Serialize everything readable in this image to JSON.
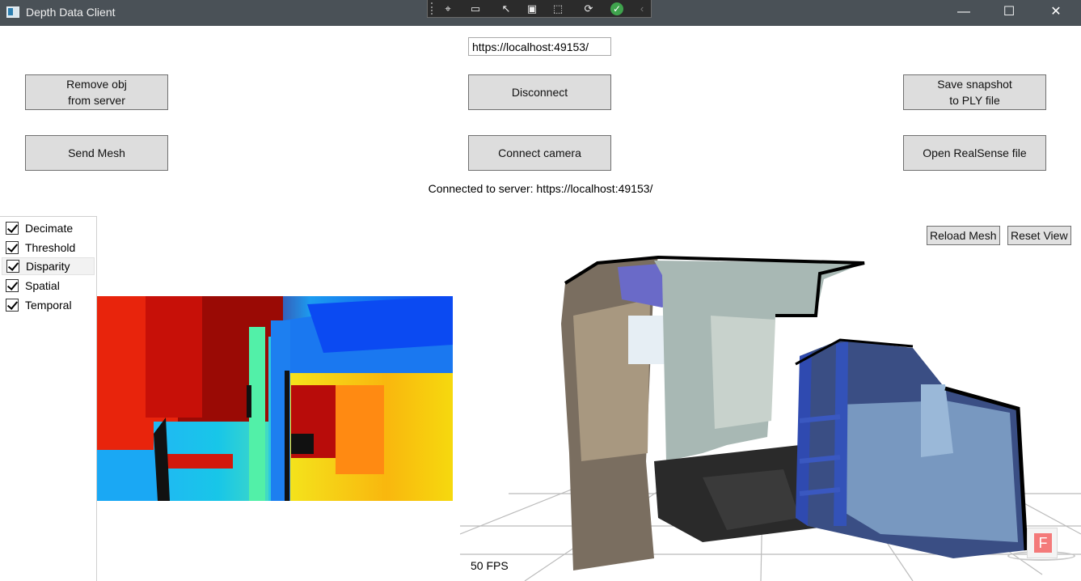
{
  "window": {
    "title": "Depth Data Client",
    "minimize_glyph": "—",
    "maximize_glyph": "☐",
    "close_glyph": "✕"
  },
  "debug_toolbar": {
    "icons": [
      "select-element-icon",
      "video-icon",
      "pointer-select-icon",
      "display-layout-adorners-icon",
      "track-focused-element-icon",
      "hot-reload-icon",
      "check-icon",
      "collapse-chevron-icon"
    ]
  },
  "connection": {
    "url": "https://localhost:49153/",
    "status": "Connected to server: https://localhost:49153/"
  },
  "buttons": {
    "remove_obj": "Remove obj\nfrom server",
    "disconnect": "Disconnect",
    "save_snapshot": "Save snapshot\nto PLY file",
    "send_mesh": "Send Mesh",
    "connect_camera": "Connect camera",
    "open_realsense": "Open RealSense file",
    "reload_mesh": "Reload Mesh",
    "reset_view": "Reset View"
  },
  "filters": [
    {
      "label": "Decimate",
      "checked": true
    },
    {
      "label": "Threshold",
      "checked": true
    },
    {
      "label": "Disparity",
      "checked": true,
      "selected": true
    },
    {
      "label": "Spatial",
      "checked": true
    },
    {
      "label": "Temporal",
      "checked": true
    }
  ],
  "view3d": {
    "fps": "50 FPS",
    "cube_letter": "F"
  },
  "colors": {
    "titlebar": "#4a5157",
    "button_bg": "#dddddd",
    "button_border": "#707070"
  }
}
